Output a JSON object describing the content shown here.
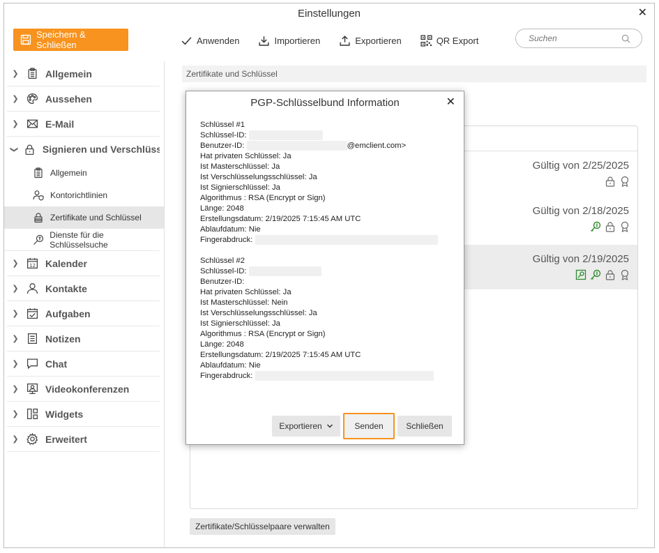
{
  "window": {
    "title": "Einstellungen",
    "close_glyph": "✕"
  },
  "toolbar": {
    "save_label": "Speichern & Schließen",
    "apply_label": "Anwenden",
    "import_label": "Importieren",
    "export_label": "Exportieren",
    "qr_label": "QR Export"
  },
  "search": {
    "placeholder": "Suchen"
  },
  "sidebar": {
    "items": [
      {
        "label": "Allgemein",
        "icon": "clipboard-icon",
        "expanded": false
      },
      {
        "label": "Aussehen",
        "icon": "palette-icon",
        "expanded": false
      },
      {
        "label": "E-Mail",
        "icon": "envelope-icon",
        "expanded": false
      },
      {
        "label": "Signieren und Verschlüsselung",
        "icon": "lock-icon",
        "expanded": true
      },
      {
        "label": "Kalender",
        "icon": "calendar-icon",
        "expanded": false
      },
      {
        "label": "Kontakte",
        "icon": "person-icon",
        "expanded": false
      },
      {
        "label": "Aufgaben",
        "icon": "task-icon",
        "expanded": false
      },
      {
        "label": "Notizen",
        "icon": "note-icon",
        "expanded": false
      },
      {
        "label": "Chat",
        "icon": "chat-icon",
        "expanded": false
      },
      {
        "label": "Videokonferenzen",
        "icon": "video-icon",
        "expanded": false
      },
      {
        "label": "Widgets",
        "icon": "widgets-icon",
        "expanded": false
      },
      {
        "label": "Erweitert",
        "icon": "gear-icon",
        "expanded": false
      }
    ],
    "subitems": [
      {
        "label": "Allgemein",
        "icon": "clipboard-icon",
        "active": false
      },
      {
        "label": "Kontorichtlinien",
        "icon": "person-shield-icon",
        "active": false
      },
      {
        "label": "Zertifikate und Schlüssel",
        "icon": "lock-icon",
        "active": true
      },
      {
        "label": "Dienste für die Schlüsselsuche",
        "icon": "key-search-icon",
        "active": false
      }
    ]
  },
  "content": {
    "section_title": "Zertifikate und Schlüssel",
    "certs": [
      {
        "valid": "Gültig von 2/25/2025",
        "icons": [
          "lock-icon",
          "ribbon-icon"
        ],
        "selected": false
      },
      {
        "valid": "Gültig von 2/18/2025",
        "icons": [
          "key-icon",
          "lock-icon",
          "ribbon-icon"
        ],
        "selected": false
      },
      {
        "valid": "Gültig von 2/19/2025",
        "icons": [
          "key-doc-icon",
          "key-icon",
          "lock-icon",
          "ribbon-icon"
        ],
        "selected": true
      }
    ],
    "manage_label": "Zertifikate/Schlüsselpaare verwalten"
  },
  "dialog": {
    "title": "PGP-Schlüsselbund Information",
    "close_glyph": "✕",
    "key1": {
      "header": "Schlüssel #1",
      "id_label": "Schlüssel-ID:",
      "user_label": "Benutzer-ID:",
      "user_suffix": "@emclient.com>",
      "private": "Hat privaten Schlüssel: Ja",
      "master": "Ist Masterschlüssel: Ja",
      "enc": "Ist Verschlüsselungsschlüssel: Ja",
      "sign": "Ist Signierschlüssel: Ja",
      "algo": "Algorithmus : RSA (Encrypt or Sign)",
      "length": "Länge: 2048",
      "created": "Erstellungsdatum: 2/19/2025 7:15:45 AM UTC",
      "expiry": "Ablaufdatum: Nie",
      "fingerprint_label": "Fingerabdruck:"
    },
    "key2": {
      "header": "Schlüssel #2",
      "id_label": "Schlüssel-ID:",
      "user_label": "Benutzer-ID:",
      "private": "Hat privaten Schlüssel: Ja",
      "master": "Ist Masterschlüssel: Nein",
      "enc": "Ist Verschlüsselungsschlüssel: Ja",
      "sign": "Ist Signierschlüssel: Ja",
      "algo": "Algorithmus : RSA (Encrypt or Sign)",
      "length": "Länge: 2048",
      "created": "Erstellungsdatum: 2/19/2025 7:15:45 AM UTC",
      "expiry": "Ablaufdatum: Nie",
      "fingerprint_label": "Fingerabdruck:"
    },
    "export_label": "Exportieren",
    "send_label": "Senden",
    "close_label": "Schließen"
  },
  "colors": {
    "accent": "#f7931e",
    "green_icon": "#2e8b2e"
  }
}
